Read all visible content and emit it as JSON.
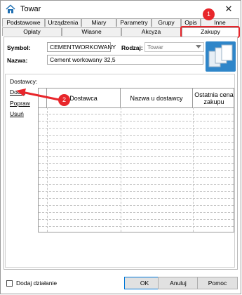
{
  "window": {
    "title": "Towar"
  },
  "tabs_row1": [
    {
      "label": "Podstawowe"
    },
    {
      "label": "Urządzenia"
    },
    {
      "label": "Miary"
    },
    {
      "label": "Parametry"
    },
    {
      "label": "Grupy"
    },
    {
      "label": "Opis"
    },
    {
      "label": "Inne"
    }
  ],
  "tabs_row2": [
    {
      "label": "Opłaty"
    },
    {
      "label": "Własne"
    },
    {
      "label": "Akcyza"
    },
    {
      "label": "Zakupy",
      "active": true
    }
  ],
  "form": {
    "symbol_label": "Symbol:",
    "symbol_value": "CEMENTWORKOWANY",
    "rodzaj_label": "Rodzaj:",
    "rodzaj_value": "Towar",
    "nazwa_label": "Nazwa:",
    "nazwa_value": "Cement workowany 32,5"
  },
  "dostawcy": {
    "group_label": "Dostawcy:",
    "actions": [
      {
        "label": "Dodaj"
      },
      {
        "label": "Popraw"
      },
      {
        "label": "Usuń"
      }
    ],
    "columns": [
      "Dostawca",
      "Nazwa u dostawcy",
      "Ostatnia cena zakupu"
    ],
    "rows": []
  },
  "annotations": [
    {
      "label": "1"
    },
    {
      "label": "2"
    }
  ],
  "bottom": {
    "add_action_label": "Dodaj działanie",
    "ok_label": "OK",
    "cancel_label": "Anuluj",
    "help_label": "Pomoc"
  },
  "colors": {
    "annotation": "#e8262b",
    "accent": "#0078d7"
  }
}
